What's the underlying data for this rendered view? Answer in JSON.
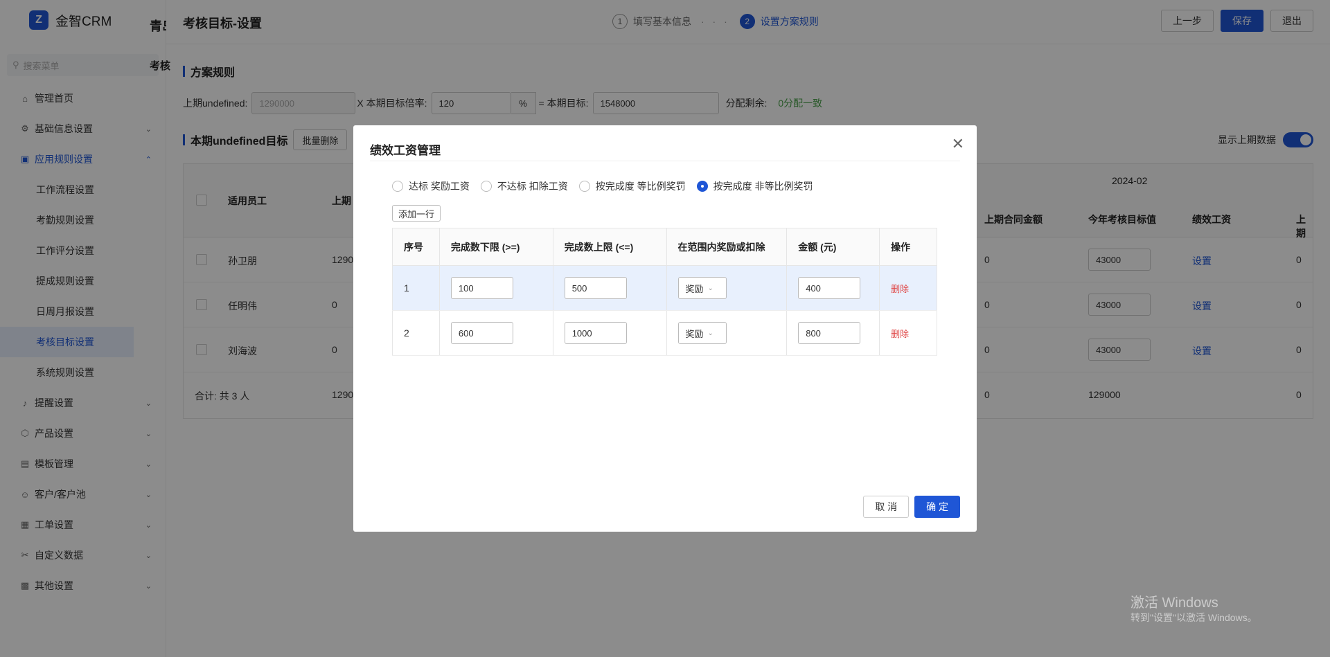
{
  "app": {
    "logo_mark": "Z",
    "name": "金智CRM"
  },
  "sidebar": {
    "search_placeholder": "搜索菜单",
    "items": [
      {
        "label": "管理首页",
        "icon": "home-icon"
      },
      {
        "label": "基础信息设置",
        "icon": "gear-icon"
      },
      {
        "label": "应用规则设置",
        "icon": "app-icon"
      },
      {
        "label": "提醒设置",
        "icon": "bell-icon"
      },
      {
        "label": "产品设置",
        "icon": "box-icon"
      },
      {
        "label": "模板管理",
        "icon": "template-icon"
      },
      {
        "label": "客户/客户池",
        "icon": "user-icon"
      },
      {
        "label": "工单设置",
        "icon": "ticket-icon"
      },
      {
        "label": "自定义数据",
        "icon": "tools-icon"
      },
      {
        "label": "其他设置",
        "icon": "grid-icon"
      }
    ],
    "sub_items": [
      "工作流程设置",
      "考勤规则设置",
      "工作评分设置",
      "提成规则设置",
      "日周月报设置",
      "考核目标设置",
      "系统规则设置"
    ]
  },
  "background": {
    "tab_text": "青岛",
    "kaohe_text": "考核"
  },
  "header": {
    "title": "考核目标-设置",
    "steps": [
      {
        "num": "1",
        "label": "填写基本信息"
      },
      {
        "num": "2",
        "label": "设置方案规则"
      }
    ],
    "step_separator": "· · ·",
    "buttons": {
      "prev": "上一步",
      "save": "保存",
      "exit": "退出"
    }
  },
  "rules": {
    "section_title": "方案规则",
    "last_label": "上期undefined:",
    "last_value": "1290000",
    "rate_label": "X 本期目标倍率:",
    "rate_value": "120",
    "rate_suffix": "%",
    "target_label": "= 本期目标:",
    "target_value": "1548000",
    "remain_label": "分配剩余:",
    "remain_value": "0分配一致"
  },
  "current_section": {
    "title": "本期undefined目标",
    "batch_delete": "批量删除",
    "show_last_label": "显示上期数据"
  },
  "bg_table": {
    "month": "2024-02",
    "headers": {
      "employee": "适用员工",
      "last": "上期",
      "last_contract": "上期合同金额",
      "year_target": "今年考核目标值",
      "salary": "绩效工资",
      "last2": "上期"
    },
    "rows": [
      {
        "name": "孙卫朋",
        "last": "1290",
        "contract": "0",
        "target": "43000",
        "action": "设置",
        "tail": "0"
      },
      {
        "name": "任明伟",
        "last": "0",
        "contract": "0",
        "target": "43000",
        "action": "设置",
        "tail": "0"
      },
      {
        "name": "刘海波",
        "last": "0",
        "contract": "0",
        "target": "43000",
        "action": "设置",
        "tail": "0"
      }
    ],
    "total": {
      "label": "合计: 共 3 人",
      "last": "1290",
      "contract": "0",
      "target": "129000",
      "tail": "0"
    }
  },
  "dialog": {
    "title": "绩效工资管理",
    "radios": [
      "达标 奖励工资",
      "不达标 扣除工资",
      "按完成度 等比例奖罚",
      "按完成度 非等比例奖罚"
    ],
    "selected_radio": 3,
    "add_row": "添加一行",
    "columns": [
      "序号",
      "完成数下限 (>=)",
      "完成数上限 (<=)",
      "在范围内奖励或扣除",
      "金额 (元)",
      "操作"
    ],
    "rows": [
      {
        "no": "1",
        "lower": "100",
        "upper": "500",
        "type": "奖励",
        "amount": "400",
        "action": "删除"
      },
      {
        "no": "2",
        "lower": "600",
        "upper": "1000",
        "type": "奖励",
        "amount": "800",
        "action": "删除"
      }
    ],
    "cancel": "取 消",
    "confirm": "确 定"
  },
  "watermark": {
    "line1": "激活 Windows",
    "line2": "转到\"设置\"以激活 Windows。"
  }
}
